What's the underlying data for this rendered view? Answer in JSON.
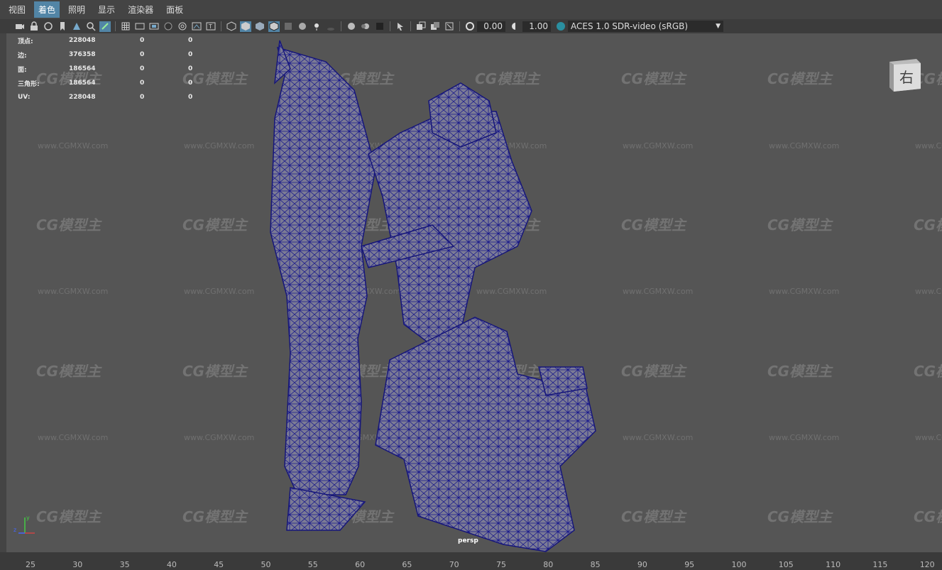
{
  "menu": [
    "视图",
    "着色",
    "照明",
    "显示",
    "渲染器",
    "面板"
  ],
  "active_menu_index": 1,
  "toolbar": {
    "exposure": "0.00",
    "gamma": "1.00",
    "color_space": "ACES 1.0 SDR-video (sRGB)"
  },
  "hud": [
    {
      "label": "顶点:",
      "value": "228048",
      "a": "0",
      "b": "0"
    },
    {
      "label": "边:",
      "value": "376358",
      "a": "0",
      "b": "0"
    },
    {
      "label": "面:",
      "value": "186564",
      "a": "0",
      "b": "0"
    },
    {
      "label": "三角形:",
      "value": "186564",
      "a": "0",
      "b": "0"
    },
    {
      "label": "UV:",
      "value": "228048",
      "a": "0",
      "b": "0"
    }
  ],
  "viewcube_label": "右",
  "camera_label": "persp",
  "watermark_logo": "CG模型主",
  "watermark_url": "www.CGMXW.com",
  "ruler": [
    "25",
    "30",
    "35",
    "40",
    "45",
    "50",
    "55",
    "60",
    "65",
    "70",
    "75",
    "80",
    "85",
    "90",
    "95",
    "100",
    "105",
    "110",
    "115",
    "120"
  ],
  "colors": {
    "wire": "#1a1a8c",
    "mesh": "#7a7a9a",
    "active": "#5285a6"
  }
}
